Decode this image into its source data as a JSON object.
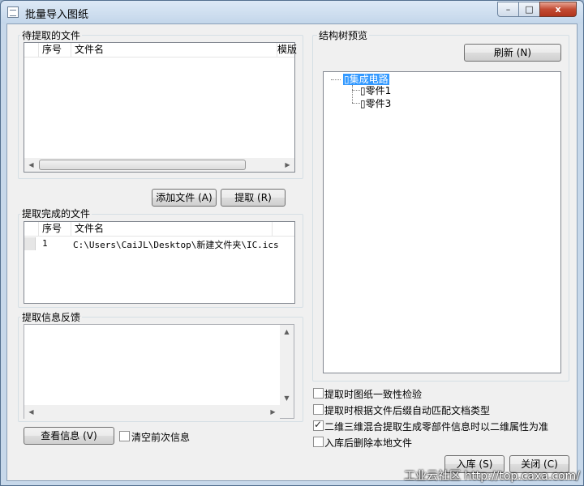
{
  "window": {
    "title": "批量导入图纸",
    "minimize": "–",
    "maximize": "□",
    "close": "x"
  },
  "pending_files": {
    "label": "待提取的文件",
    "columns": [
      "序号",
      "文件名",
      "模版"
    ]
  },
  "extract_buttons": {
    "add_file": "添加文件 (A)",
    "extract": "提取 (R)"
  },
  "completed_files": {
    "label": "提取完成的文件",
    "columns": [
      "序号",
      "文件名"
    ],
    "rows": [
      {
        "index": "1",
        "filename": "C:\\Users\\CaiJL\\Desktop\\新建文件夹\\IC.ics"
      }
    ]
  },
  "feedback": {
    "label": "提取信息反馈",
    "view_info": "查看信息 (V)",
    "clear_previous": "清空前次信息",
    "clear_previous_checked": false
  },
  "tree_preview": {
    "label": "结构树预览",
    "refresh": "刷新 (N)",
    "root": "集成电路",
    "children": [
      "零件1",
      "零件3"
    ]
  },
  "options": [
    {
      "label": "提取时图纸一致性检验",
      "checked": false
    },
    {
      "label": "提取时根据文件后缀自动匹配文档类型",
      "checked": false
    },
    {
      "label": "二维三维混合提取生成零部件信息时以二维属性为准",
      "checked": true
    },
    {
      "label": "入库后删除本地文件",
      "checked": false
    }
  ],
  "footer": {
    "store": "入库 (S)",
    "close": "关闭 (C)"
  },
  "watermark": "工业云社区 http://top.caxa.com/"
}
